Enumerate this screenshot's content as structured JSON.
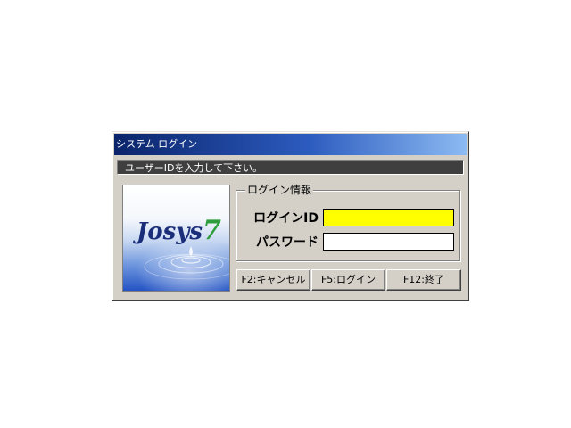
{
  "window": {
    "title": "システム ログイン"
  },
  "message": "ユーザーIDを入力して下さい。",
  "logo": {
    "text": "Josys",
    "accent": "7"
  },
  "login_group": {
    "legend": "ログイン情報",
    "fields": [
      {
        "label": "ログインID",
        "value": "",
        "background": "#ffff00"
      },
      {
        "label": "パスワード",
        "value": "",
        "background": "#ffffff"
      }
    ]
  },
  "buttons": {
    "cancel": "F2:キャンセル",
    "login": "F5:ログイン",
    "exit": "F12:終了"
  },
  "colors": {
    "face": "#d4d0c8",
    "title_start": "#0a246a",
    "title_end": "#8cbaf2",
    "message_bg": "#3f3f3f",
    "active_field": "#ffff00",
    "logo_text": "#1a2e7a",
    "logo_accent": "#2e9e3c"
  }
}
